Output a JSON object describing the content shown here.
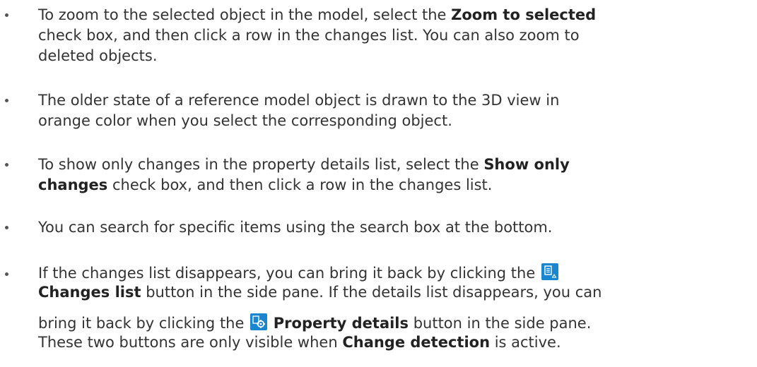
{
  "bullets": [
    {
      "lines": [
        [
          "To zoom to the selected object in the model, select the ",
          "Zoom to selected"
        ],
        [
          "check box, and then click a row in the changes list. You can also zoom to"
        ],
        [
          "deleted objects."
        ]
      ]
    },
    {
      "lines": [
        [
          "The older state of a reference model object is drawn to the 3D view in"
        ],
        [
          "orange color when you select the corresponding object."
        ]
      ]
    },
    {
      "lines": [
        [
          "To show only changes in the property details list, select the ",
          "Show only"
        ],
        [
          "changes",
          " check box, and then click a row in the changes list."
        ]
      ]
    },
    {
      "lines": [
        [
          "You can search for specific items using the search box at the bottom."
        ]
      ]
    },
    {
      "l1_pre": "If the changes list disappears, you can bring it back by clicking the",
      "l2_bold": "Changes list",
      "l2_rest": " button in the side pane. If the details list disappears, you can",
      "l3_pre": "bring it back by clicking the",
      "l3_bold": "Property details",
      "l3_rest": " button in the side pane.",
      "l4_pre": "These two buttons are only visible when ",
      "l4_bold": "Change detection",
      "l4_rest": " is active."
    }
  ],
  "icons": {
    "changes_list": "changes-list-icon",
    "property_details": "property-details-icon",
    "accent": "#1a86d0"
  }
}
